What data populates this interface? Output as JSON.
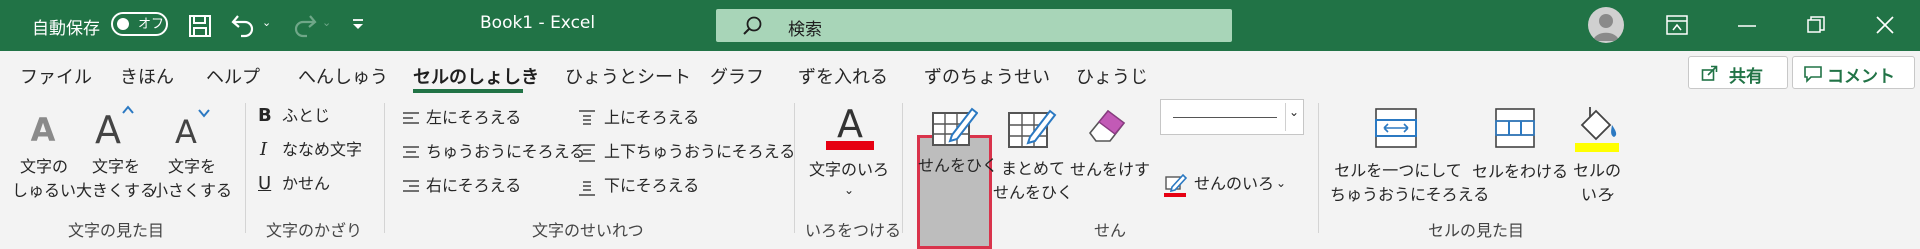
{
  "titlebar": {
    "autosave_label": "自動保存",
    "autosave_state": "オフ",
    "doc_title": "Book1 - Excel",
    "search_placeholder": "検索"
  },
  "tabs": [
    {
      "label": "ファイル",
      "active": false
    },
    {
      "label": "きほん",
      "active": false
    },
    {
      "label": "ヘルプ",
      "active": false
    },
    {
      "label": "へんしゅう",
      "active": false
    },
    {
      "label": "セルのしょしき",
      "active": true
    },
    {
      "label": "ひょうとシート",
      "active": false
    },
    {
      "label": "グラフ",
      "active": false
    },
    {
      "label": "ずを入れる",
      "active": false
    },
    {
      "label": "ずのちょうせい",
      "active": false
    },
    {
      "label": "ひょうじ",
      "active": false
    }
  ],
  "share_label": "共有",
  "comment_label": "コメント",
  "groups": {
    "font_look": {
      "label": "文字の見た目",
      "btn_kind": [
        "文字の",
        "しゅるい"
      ],
      "btn_bigger": [
        "文字を",
        "大きくする"
      ],
      "btn_smaller": [
        "文字を",
        "小さくする"
      ]
    },
    "font_deco": {
      "label": "文字のかざり",
      "bold": "ふとじ",
      "italic": "ななめ文字",
      "underline": "かせん"
    },
    "align": {
      "label": "文字のせいれつ",
      "left": "左にそろえる",
      "center": "ちゅうおうにそろえる",
      "right": "右にそろえる",
      "top": "上にそろえる",
      "middle": "上下ちゅうおうにそろえる",
      "bottom": "下にそろえる"
    },
    "color": {
      "label": "いろをつける",
      "font_color": "文字のいろ"
    },
    "border": {
      "label": "せん",
      "draw": "せんをひく",
      "draw_all": [
        "まとめて",
        "せんをひく"
      ],
      "erase": "せんをけす",
      "line_color": "せんのいろ"
    },
    "cell_look": {
      "label": "セルの見た目",
      "merge": [
        "セルを一つにして",
        "ちゅうおうにそろえる"
      ],
      "split": "セルをわける",
      "fill": [
        "セルの",
        "いろ"
      ]
    }
  },
  "colors": {
    "titlebar": "#217346",
    "accent": "#217346",
    "highlight_border": "#d9334b",
    "font_color_bar": "#e60012",
    "fill_color_bar": "#ffff00"
  }
}
